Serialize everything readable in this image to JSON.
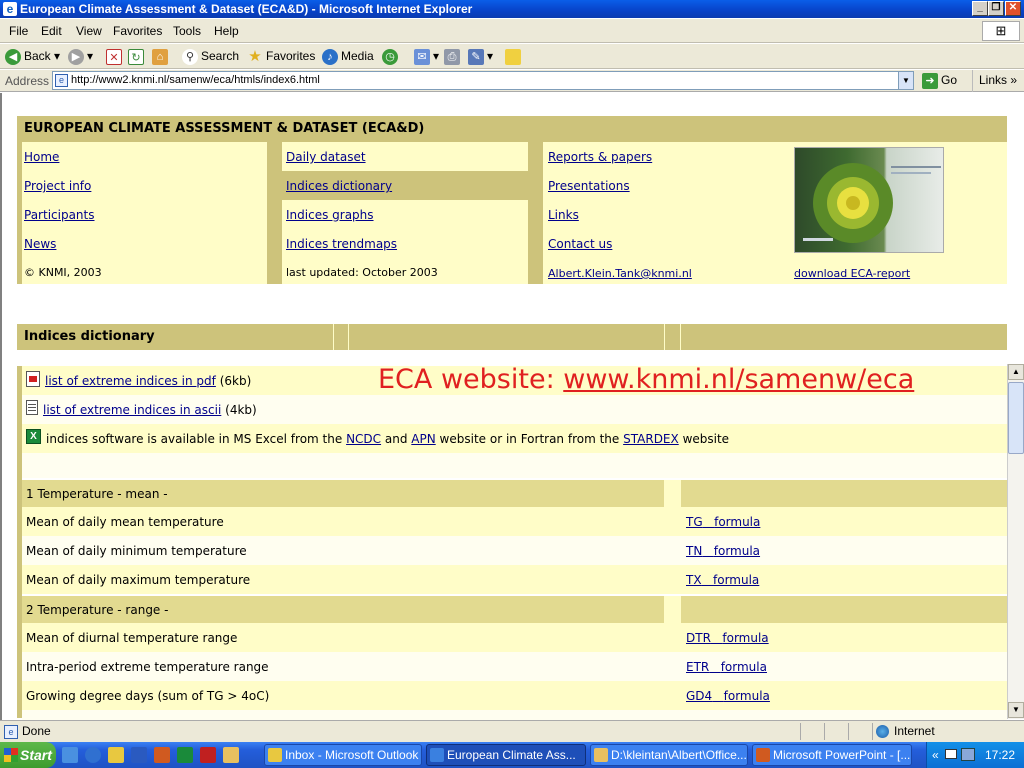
{
  "window": {
    "title": "European Climate Assessment & Dataset (ECA&D) - Microsoft Internet Explorer"
  },
  "menu": [
    "File",
    "Edit",
    "View",
    "Favorites",
    "Tools",
    "Help"
  ],
  "toolbar": {
    "back": "Back",
    "search": "Search",
    "favorites": "Favorites",
    "media": "Media"
  },
  "address": {
    "label": "Address",
    "url": "http://www2.knmi.nl/samenw/eca/htmls/index6.html",
    "go": "Go",
    "links": "Links"
  },
  "site": {
    "header": "EUROPEAN CLIMATE ASSESSMENT & DATASET (ECA&D)",
    "nav_col1": [
      "Home",
      "Project info",
      "Participants",
      "News"
    ],
    "nav_col2": [
      "Daily dataset",
      "Indices dictionary",
      "Indices graphs",
      "Indices trendmaps"
    ],
    "nav_col3": [
      "Reports & papers",
      "Presentations",
      "Links",
      "Contact us"
    ],
    "copyright": "© KNMI, 2003",
    "updated": "last updated: October 2003",
    "email": "Albert.Klein.Tank@knmi.nl",
    "download": "download ECA-report"
  },
  "section": {
    "title": "Indices dictionary",
    "pdf_link": "list of extreme indices in pdf",
    "pdf_size": "(6kb)",
    "ascii_link": "list of extreme indices in ascii",
    "ascii_size": "(4kb)",
    "software_pre": "indices software is available in MS Excel from the",
    "ncdc": "NCDC",
    "and": "and",
    "apn": "APN",
    "software_mid": "website or in Fortran from the",
    "stardex": "STARDEX",
    "software_post": "website",
    "overlay_prefix": "ECA website: ",
    "overlay_url": "www.knmi.nl/samenw/eca"
  },
  "groups": [
    {
      "title": "1 Temperature - mean -",
      "rows": [
        {
          "name": "Mean of daily mean temperature",
          "code": "TG",
          "formula": "formula"
        },
        {
          "name": "Mean of daily minimum temperature",
          "code": "TN",
          "formula": "formula"
        },
        {
          "name": "Mean of daily maximum temperature",
          "code": "TX",
          "formula": "formula"
        }
      ]
    },
    {
      "title": "2 Temperature - range -",
      "rows": [
        {
          "name": "Mean of diurnal temperature range",
          "code": "DTR",
          "formula": "formula"
        },
        {
          "name": "Intra-period extreme temperature range",
          "code": "ETR",
          "formula": "formula"
        },
        {
          "name": "Growing degree days (sum of TG > 4oC)",
          "code": "GD4",
          "formula": "formula"
        }
      ]
    }
  ],
  "status": {
    "text": "Done",
    "zone": "Internet"
  },
  "taskbar": {
    "start": "Start",
    "tasks": [
      "Inbox - Microsoft Outlook",
      "European Climate Ass...",
      "D:\\kleintan\\Albert\\Office...",
      "Microsoft PowerPoint - [..."
    ],
    "clock": "17:22"
  }
}
